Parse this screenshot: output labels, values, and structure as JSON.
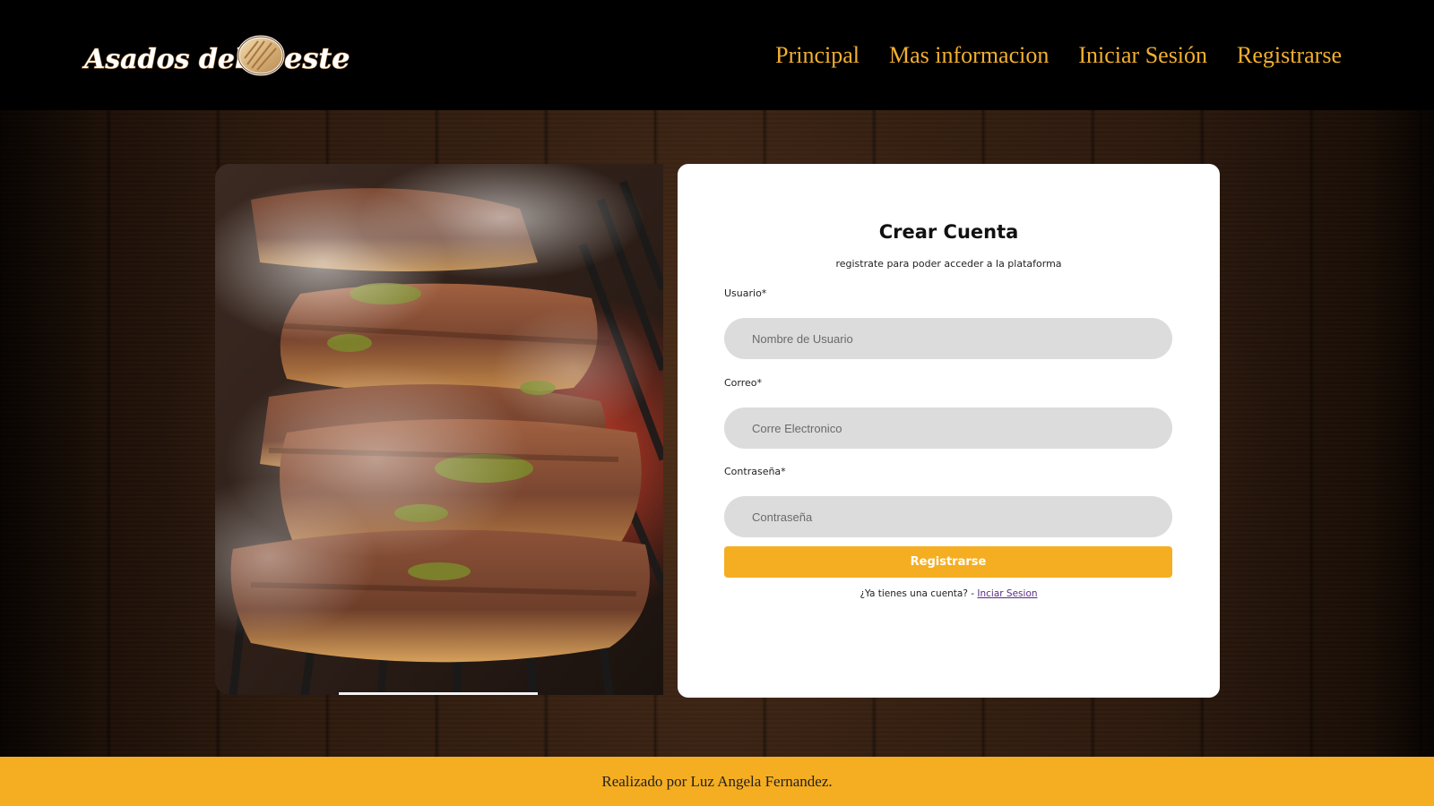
{
  "brand": {
    "logo_text_1": "Asados del",
    "logo_text_2": "este"
  },
  "nav": {
    "items": [
      {
        "label": "Principal"
      },
      {
        "label": "Mas informacion"
      },
      {
        "label": "Iniciar Sesión"
      },
      {
        "label": "Registrarse"
      }
    ]
  },
  "form": {
    "title": "Crear Cuenta",
    "subtitle": "registrate para poder acceder a la plataforma",
    "username": {
      "label": "Usuario*",
      "placeholder": "Nombre de Usuario",
      "value": ""
    },
    "email": {
      "label": "Correo*",
      "placeholder": "Corre Electronico",
      "value": ""
    },
    "password": {
      "label": "Contraseña*",
      "placeholder": "Contraseña",
      "value": ""
    },
    "submit_label": "Registrarse",
    "login_prompt": "¿Ya tienes una cuenta? - ",
    "login_link": "Inciar Sesion"
  },
  "footer": {
    "text": "Realizado por Luz Angela Fernandez."
  },
  "colors": {
    "accent": "#f5ae22",
    "nav_text": "#f2b02f",
    "header_bg": "#000000",
    "field_bg": "#dcdcdc",
    "link": "#5a2a86"
  },
  "icons": {
    "logo": "wooden-slice-logo-icon"
  }
}
